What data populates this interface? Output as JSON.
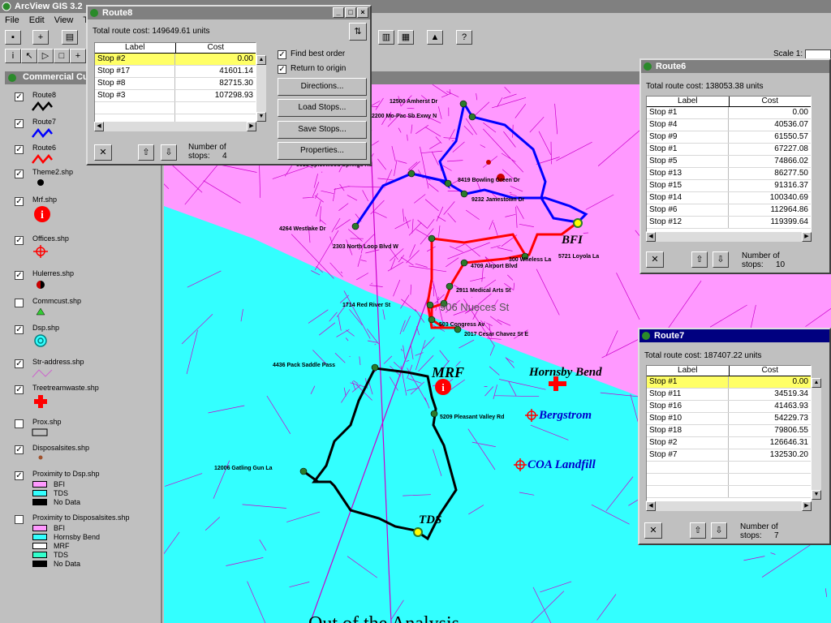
{
  "app": {
    "title": "ArcView GIS 3.2",
    "menu": [
      "File",
      "Edit",
      "View",
      "T"
    ],
    "scale_label": "Scale 1:"
  },
  "legend_panel": {
    "title": "Commercial Cu",
    "items": [
      {
        "label": "Route8",
        "checked": true,
        "symbol": "route-line-black"
      },
      {
        "label": "Route7",
        "checked": true,
        "symbol": "route-line-blue"
      },
      {
        "label": "Route6",
        "checked": true,
        "symbol": "route-line-red"
      },
      {
        "label": "Theme2.shp",
        "checked": true,
        "symbol": "black-dot"
      },
      {
        "label": "Mrf.shp",
        "checked": true,
        "symbol": "info-icon"
      },
      {
        "label": "Offices.shp",
        "checked": true,
        "symbol": "crosshair-icon"
      },
      {
        "label": "Hulerres.shp",
        "checked": true,
        "symbol": "half-circle-icon"
      },
      {
        "label": "Commcust.shp",
        "checked": false,
        "symbol": "green-triangle"
      },
      {
        "label": "Dsp.shp",
        "checked": true,
        "symbol": "target-icon"
      },
      {
        "label": "Str-address.shp",
        "checked": true,
        "symbol": "street-line"
      },
      {
        "label": "Treetreamwaste.shp",
        "checked": true,
        "symbol": "red-cross"
      },
      {
        "label": "Prox.shp",
        "checked": false,
        "symbol": "empty-box"
      },
      {
        "label": "Disposalsites.shp",
        "checked": true,
        "symbol": "brown-dot"
      },
      {
        "label": "Proximity to Dsp.shp",
        "checked": true,
        "symbol": "none"
      },
      {
        "label": "Proximity to Disposalsites.shp",
        "checked": false,
        "symbol": "none"
      }
    ],
    "dsp_classes": [
      {
        "label": "BFI",
        "color": "#ff99ff"
      },
      {
        "label": "TDS",
        "color": "#33ffff"
      },
      {
        "label": "No Data",
        "color": "#000000"
      }
    ],
    "disposal_classes": [
      {
        "label": "BFI",
        "color": "#ff99ff"
      },
      {
        "label": "Hornsby Bend",
        "color": "#33ffff"
      },
      {
        "label": "MRF",
        "color": "#ffffff"
      },
      {
        "label": "TDS",
        "color": "#33ffcc"
      },
      {
        "label": "No Data",
        "color": "#000000"
      }
    ]
  },
  "route8": {
    "title": "Route8",
    "total": "Total route cost: 149649.61 units",
    "col_label": "Label",
    "col_cost": "Cost",
    "rows": [
      {
        "label": "Stop #2",
        "cost": "0.00"
      },
      {
        "label": "Stop #17",
        "cost": "41601.14"
      },
      {
        "label": "Stop #8",
        "cost": "82715.30"
      },
      {
        "label": "Stop #3",
        "cost": "107298.93"
      }
    ],
    "find_best": "Find best order",
    "return_origin": "Return to origin",
    "btn_directions": "Directions...",
    "btn_load": "Load Stops...",
    "btn_save": "Save Stops...",
    "btn_properties": "Properties...",
    "num_label": "Number of",
    "stops_label": "stops:",
    "stops_value": "4"
  },
  "route6": {
    "title": "Route6",
    "total": "Total route cost: 138053.38 units",
    "col_label": "Label",
    "col_cost": "Cost",
    "rows": [
      {
        "label": "Stop #1",
        "cost": "0.00"
      },
      {
        "label": "Stop #4",
        "cost": "40536.07"
      },
      {
        "label": "Stop #9",
        "cost": "61550.57"
      },
      {
        "label": "Stop #1",
        "cost": "67227.08"
      },
      {
        "label": "Stop #5",
        "cost": "74866.02"
      },
      {
        "label": "Stop #13",
        "cost": "86277.50"
      },
      {
        "label": "Stop #15",
        "cost": "91316.37"
      },
      {
        "label": "Stop #14",
        "cost": "100340.69"
      },
      {
        "label": "Stop #6",
        "cost": "112964.86"
      },
      {
        "label": "Stop #12",
        "cost": "119399.64"
      }
    ],
    "num_label": "Number of",
    "stops_label": "stops:",
    "stops_value": "10"
  },
  "route7": {
    "title": "Route7",
    "total": "Total route cost: 187407.22 units",
    "col_label": "Label",
    "col_cost": "Cost",
    "rows": [
      {
        "label": "Stop #1",
        "cost": "0.00"
      },
      {
        "label": "Stop #11",
        "cost": "34519.34"
      },
      {
        "label": "Stop #16",
        "cost": "41463.93"
      },
      {
        "label": "Stop #10",
        "cost": "54229.73"
      },
      {
        "label": "Stop #18",
        "cost": "79806.55"
      },
      {
        "label": "Stop #2",
        "cost": "126646.31"
      },
      {
        "label": "Stop #7",
        "cost": "132530.20"
      }
    ],
    "num_label": "Number of",
    "stops_label": "stops:",
    "stops_value": "7"
  },
  "map": {
    "colors": {
      "bfi_zone": "#ff99ff",
      "tds_zone": "#33ffff",
      "route_black": "#000000",
      "route_blue": "#0000ff",
      "route_red": "#ff0000"
    },
    "site_labels": {
      "bfi": "BFI",
      "mrf": "MRF",
      "hornsby": "Hornsby Bend",
      "bergstrom": "Bergstrom",
      "coa": "COA Landfill",
      "tds": "TDS"
    },
    "street_labels": {
      "s1": "12500 Amherst Dr",
      "s2": "2200 Mo-Pac Sb Exwy N",
      "s3": "8419 Bowling Green Dr",
      "s4": "9232 Jamestown Dr",
      "s5": "4264 Westlake Dr",
      "s6": "2303 North Loop Blvd W",
      "s7": "4709 Airport Blvd",
      "s8": "300 Wheless La",
      "s9": "5721 Loyola La",
      "s10": "2911 Medical Arts St",
      "s11": "1714 Red River St",
      "s12": "906 Nueces St",
      "s13": "503 Congress Av",
      "s14": "2017 Cesar Chavez St E",
      "s15": "4436 Pack Saddle Pass",
      "s16": "5209 Pleasant Valley Rd",
      "s17": "12006 Gatling Gun La",
      "s18": "5018 Spicewood Springs Rd",
      "bottom": "Out of the Analysis"
    }
  }
}
